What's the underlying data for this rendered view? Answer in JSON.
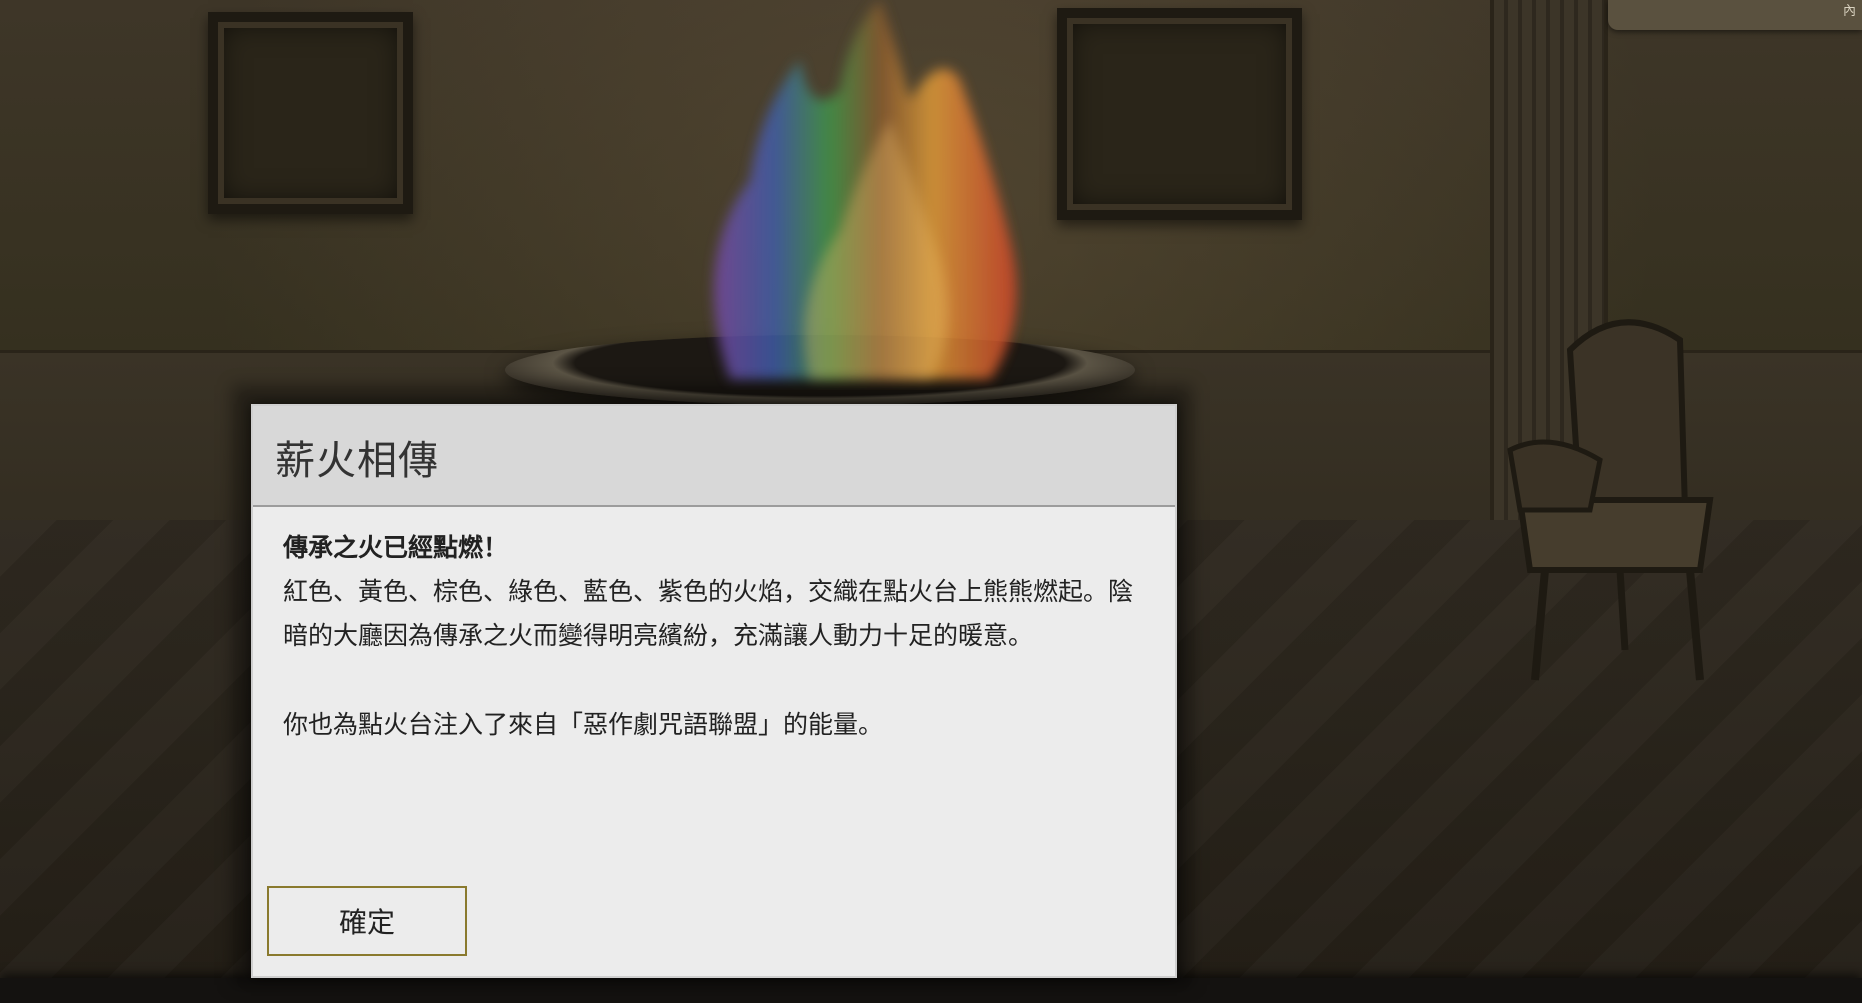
{
  "top_tab": {
    "label": "內"
  },
  "dialog": {
    "title": "薪火相傳",
    "heading": "傳承之火已經點燃！",
    "paragraph1": "紅色、黃色、棕色、綠色、藍色、紫色的火焰，交織在點火台上熊熊燃起。陰暗的大廳因為傳承之火而變得明亮繽紛，充滿讓人動力十足的暖意。",
    "paragraph2": "你也為點火台注入了來自「惡作劇咒語聯盟」的能量。",
    "confirm_label": "確定"
  },
  "colors": {
    "dialog_background": "#ececec",
    "dialog_header": "#d8d8d8",
    "button_border": "#8a7a2e",
    "flame_colors": [
      "#d6452a",
      "#e8a13a",
      "#8a5a2e",
      "#3f9a4a",
      "#3f5fb0",
      "#7a4aa8"
    ]
  }
}
